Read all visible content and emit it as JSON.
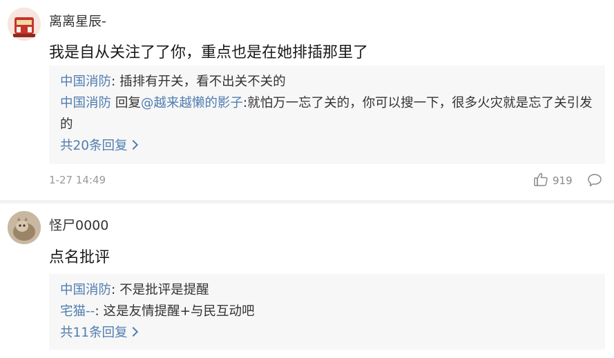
{
  "comments": [
    {
      "username": "离离星辰-",
      "text": "我是自从关注了了你，重点也是在她排插那里了",
      "replies": [
        {
          "name": "中国消防",
          "sep": ":",
          "text": " 插排有开关，看不出关不关的"
        },
        {
          "name": "中国消防",
          "prefix": " 回复",
          "mention": "@越来越懒的影子",
          "sep": ":",
          "text": "就怕万一忘了关的，你可以搜一下，很多火灾就是忘了关引发的"
        }
      ],
      "more_replies": "共20条回复",
      "timestamp": "1-27 14:49",
      "likes": "919"
    },
    {
      "username": "怪尸0000",
      "text": "点名批评",
      "replies": [
        {
          "name": "中国消防",
          "sep": ":",
          "text": " 不是批评是提醒"
        },
        {
          "name": "宅猫--",
          "sep": ":",
          "text": " 这是友情提醒+与民互动吧"
        }
      ],
      "more_replies": "共11条回复"
    }
  ],
  "colors": {
    "link": "#507daf",
    "reply_bg": "#f7f7f7",
    "meta": "#999999"
  },
  "icons": [
    "avatar",
    "thumbs-up-icon",
    "comment-bubble-icon",
    "chevron-right-icon"
  ]
}
